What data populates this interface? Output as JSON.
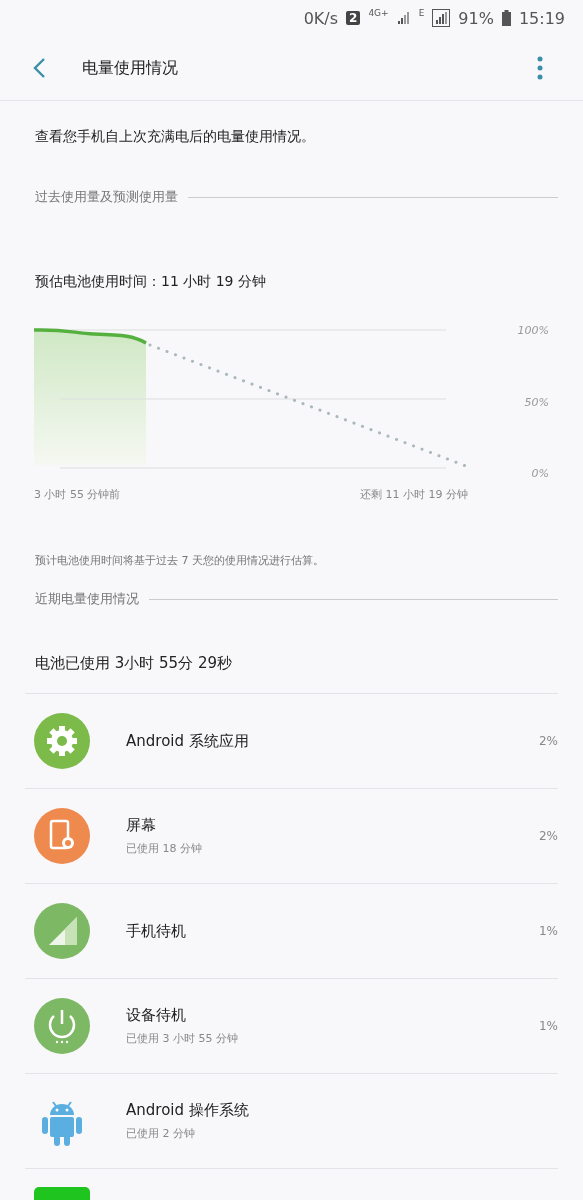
{
  "status_bar": {
    "speed": "0K/s",
    "sim": "2",
    "network": "4G+",
    "network2": "E",
    "battery": "91%",
    "time": "15:19"
  },
  "header": {
    "title": "电量使用情况"
  },
  "description": "查看您手机自上次充满电后的电量使用情况。",
  "section_past": "过去使用量及预测使用量",
  "estimate": "预估电池使用时间：11 小时 19 分钟",
  "chart": {
    "ytick_labels": [
      "100%",
      "50%",
      "0%"
    ],
    "start_label": "3 小时 55 分钟前",
    "end_label": "还剩 11 小时 19 分钟"
  },
  "note": "预计电池使用时间将基于过去 7 天您的使用情况进行估算。",
  "section_recent": "近期电量使用情况",
  "battery_used": "电池已使用 3小时 55分 29秒",
  "items": [
    {
      "kind": "system",
      "name": "Android 系统应用",
      "percent": "2%"
    },
    {
      "kind": "screen",
      "name": "屏幕",
      "detail": "已使用 18 分钟",
      "percent": "2%"
    },
    {
      "kind": "cell",
      "name": "手机待机",
      "percent": "1%"
    },
    {
      "kind": "idle",
      "name": "设备待机",
      "detail": "已使用 3 小时 55 分钟",
      "percent": "1%"
    },
    {
      "kind": "android",
      "name": "Android 操作系统",
      "detail": "已使用 2 分钟"
    }
  ]
}
